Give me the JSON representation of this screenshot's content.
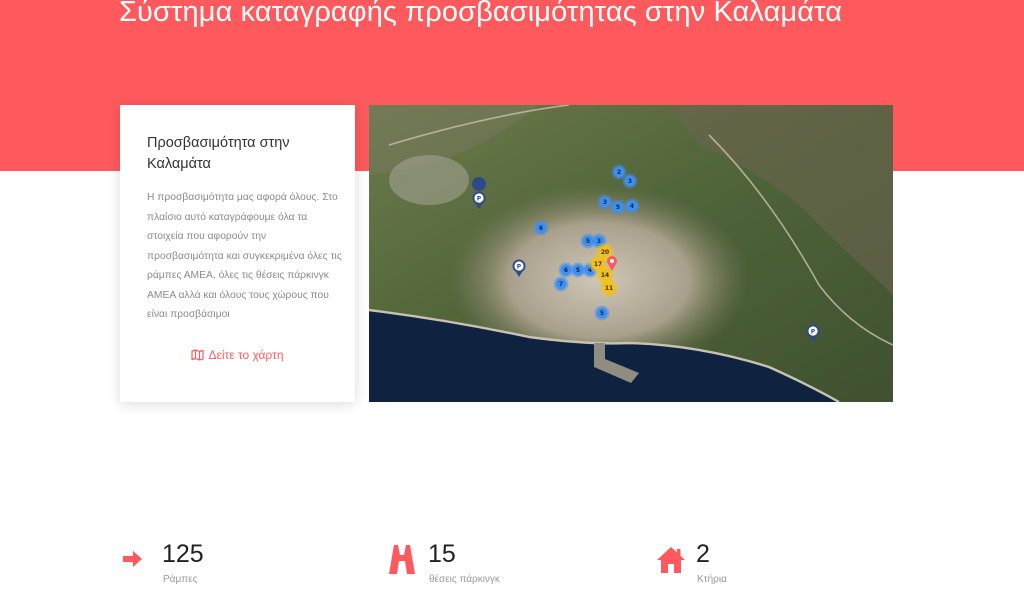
{
  "header": {
    "title": "Σύστημα καταγραφής προσβασιμότητας στην Καλαμάτα"
  },
  "card": {
    "title": "Προσβασιμότητα στην Καλαμάτα",
    "text": "Η προσβασιμότητα μας αφορά όλους. Στο πλαίσιο αυτό καταγράφουμε όλα τα στοιχεία που αφορούν την προσβασιμότητα και συγκεκριμένα όλες τις ράμπες ΑΜΕΑ, όλες τις θέσεις πάρκινγκ ΑΜΕΑ αλλά και όλους τους χώρους που είναι προσβάσιμοι",
    "link_label": "Δείτε το χάρτη",
    "link_icon": "map-icon"
  },
  "map": {
    "parking_marker_label": "P",
    "clusters": [
      {
        "label": "2",
        "color": "blue"
      },
      {
        "label": "3",
        "color": "blue"
      },
      {
        "label": "3",
        "color": "blue"
      },
      {
        "label": "5",
        "color": "blue"
      },
      {
        "label": "4",
        "color": "blue"
      },
      {
        "label": "6",
        "color": "blue"
      },
      {
        "label": "5",
        "color": "blue"
      },
      {
        "label": "3",
        "color": "blue"
      },
      {
        "label": "6",
        "color": "blue"
      },
      {
        "label": "5",
        "color": "blue"
      },
      {
        "label": "4",
        "color": "blue"
      },
      {
        "label": "7",
        "color": "blue"
      },
      {
        "label": "5",
        "color": "blue"
      },
      {
        "label": "20",
        "color": "yellow"
      },
      {
        "label": "17",
        "color": "yellow"
      },
      {
        "label": "14",
        "color": "yellow"
      },
      {
        "label": "11",
        "color": "yellow"
      }
    ],
    "colors": {
      "blue": "#3d8ff0",
      "yellow": "#f2c018",
      "parking": "#2f4a8a",
      "sea": "#0f2340"
    }
  },
  "stats": [
    {
      "value": "125",
      "label": "Ράμπες",
      "icon": "arrow-right-icon"
    },
    {
      "value": "15",
      "label": "θέσεις πάρκινγκ",
      "icon": "road-icon"
    },
    {
      "value": "2",
      "label": "Κτήρια",
      "icon": "home-icon"
    }
  ],
  "colors": {
    "accent": "#fe5a5d",
    "text": "#333333",
    "muted": "#8a8a8a"
  }
}
